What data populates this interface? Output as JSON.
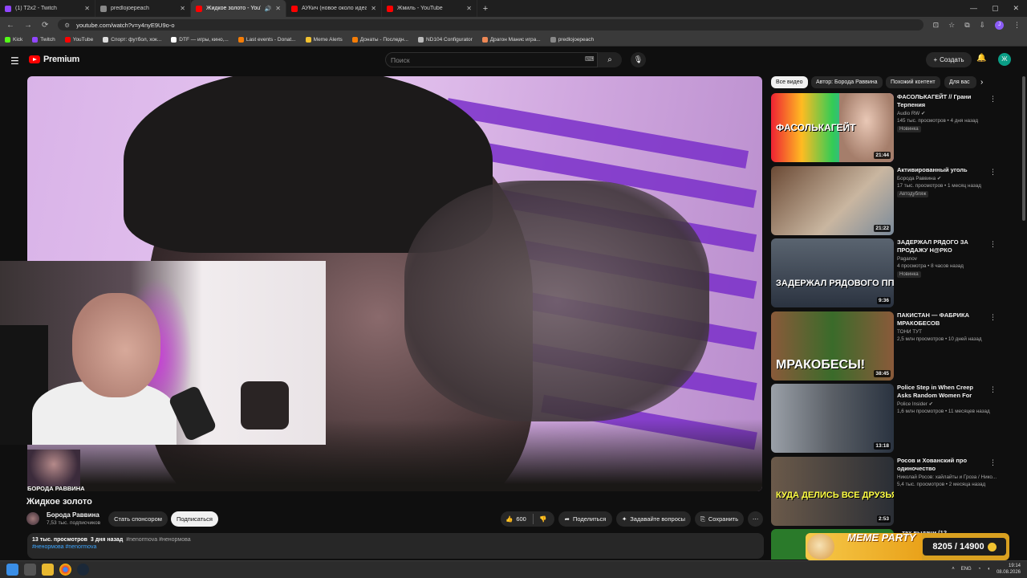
{
  "browser": {
    "tabs": [
      {
        "title": "(1) T2x2 - Twitch",
        "color": "#9146ff"
      },
      {
        "title": "predlojoepeach",
        "color": "#888888"
      },
      {
        "title": "Жидкое золото - YouTube",
        "color": "#ff0000",
        "active": true
      },
      {
        "title": "АУКич (новое около идеальн",
        "color": "#ff0000"
      },
      {
        "title": "Жмиль - YouTube",
        "color": "#ff0000"
      }
    ],
    "url": "youtube.com/watch?v=y4nyE9U9o-o",
    "profile_initial": "J",
    "bookmarks": [
      "Kick",
      "Twitch",
      "YouTube",
      "Спорт: футбол, хок...",
      "DTF — игры, кино,...",
      "Last events - Donat...",
      "Meme Alerts",
      "Донаты - Последн...",
      "ND104 Configurator",
      "Драгон Манис игра...",
      "predlojoepeach"
    ]
  },
  "yt": {
    "logo": "Premium",
    "search_placeholder": "Поиск",
    "create": "Создать",
    "avatar_initial": "Ж"
  },
  "video": {
    "channel_overlay": "БОРОДА РАВВИНА",
    "title": "Жидкое золото",
    "channel": "Борода Раввина",
    "subscribers": "7,53 тыс. подписчиков",
    "sponsor": "Стать спонсором",
    "subscribe": "Подписаться",
    "likes": "600",
    "share": "Поделиться",
    "ask": "Задавайте вопросы",
    "save": "Сохранить",
    "views": "13 тыс. просмотров",
    "age": "3 дня назад",
    "tags_line1": "#nenormova #ненормова",
    "tags_line2": "#ненормова #nenormova"
  },
  "chips": [
    "Все видео",
    "Автор: Борода Раввина",
    "Похожий контент",
    "Для вас"
  ],
  "recs": [
    {
      "title": "ФАСОЛЬКАГЕЙТ // Грани Терпения",
      "channel": "Audio RW",
      "meta": "145 тыс. просмотров • 4 дня назад",
      "badge": "Новинка",
      "duration": "21:44",
      "overlay": "ФАСОЛЬКАГЕЙТ",
      "c1": "#0f7a55",
      "c2": "#d9c0b8"
    },
    {
      "title": "Активированный уголь",
      "channel": "Борода Раввина",
      "meta": "17 тыс. просмотров • 1 месяц назад",
      "badge": "Автодубляж",
      "duration": "21:22",
      "overlay": "",
      "c1": "#6b4a35",
      "c2": "#c9b6a0"
    },
    {
      "title": "ЗАДЕРЖАЛ РЯДОГО ЗА ПРОДАЖУ Н@РКО",
      "channel": "Paganov",
      "meta": "4 просмотра • 8 часов назад",
      "badge": "Новинка",
      "duration": "9:36",
      "overlay": "ЗАДЕРЖАЛ РЯДОВОГО ППС!?",
      "c1": "#2b3340",
      "c2": "#5a6470"
    },
    {
      "title": "ПАКИСТАН — ФАБРИКА МРАКОБЕСОВ",
      "channel": "ТОНИ ТУТ",
      "meta": "2,5 млн просмотров • 10 дней назад",
      "badge": "",
      "duration": "38:45",
      "overlay": "МРАКОБЕСЫ!",
      "c1": "#3a6b2a",
      "c2": "#8a5a3a"
    },
    {
      "title": "Police Step in When Creep Asks Random Women For Threes0me",
      "channel": "Police Insider",
      "meta": "1,6 млн просмотров • 11 месяцев назад",
      "badge": "",
      "duration": "13:18",
      "overlay": "",
      "c1": "#5a5f66",
      "c2": "#9aa0a8"
    },
    {
      "title": "Росов и Хованский про одиночество",
      "channel": "Николай Росов: хайлайты и Гроза / Нико...",
      "meta": "5,4 тыс. просмотров • 2 месяца назад",
      "badge": "",
      "duration": "2:53",
      "overlay": "КУДА ДЕЛИСЬ ВСЕ ДРУЗЬЯ?",
      "c1": "#2a2e35",
      "c2": "#6b5a4a"
    },
    {
      "title": "...тах выдачи (12",
      "channel": "",
      "meta": "",
      "badge": "",
      "duration": "",
      "overlay": "",
      "c1": "#2a7a2a",
      "c2": "#3a3a3a"
    }
  ],
  "donation": {
    "label": "MEME PARTY",
    "progress": "8205 / 14900"
  },
  "taskbar": {
    "lang": "ENG",
    "time": "19:14",
    "date": "08.08.2026"
  }
}
